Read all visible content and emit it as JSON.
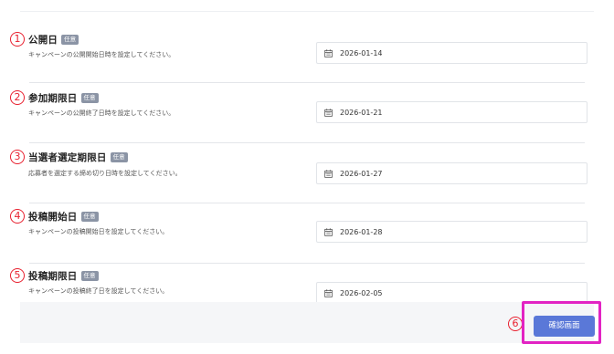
{
  "fields": [
    {
      "marker": "1",
      "title": "公開日",
      "badge": "任意",
      "description": "キャンペーンの公開開始日時を設定してください。",
      "value": "2026-01-14"
    },
    {
      "marker": "2",
      "title": "参加期限日",
      "badge": "任意",
      "description": "キャンペーンの公開終了日時を設定してください。",
      "value": "2026-01-21"
    },
    {
      "marker": "3",
      "title": "当選者選定期限日",
      "badge": "任意",
      "description": "応募者を選定する締め切り日時を設定してください。",
      "value": "2026-01-27"
    },
    {
      "marker": "4",
      "title": "投稿開始日",
      "badge": "任意",
      "description": "キャンペーンの投稿開始日を設定してください。",
      "value": "2026-01-28"
    },
    {
      "marker": "5",
      "title": "投稿期限日",
      "badge": "任意",
      "description": "キャンペーンの投稿終了日を設定してください。",
      "value": "2026-02-05"
    }
  ],
  "footer": {
    "marker": "6",
    "confirm_label": "確認画面"
  },
  "icons": {
    "field_icon": "calendar-icon"
  },
  "colors": {
    "accent": "#5a78d8",
    "marker": "#e8202f",
    "highlight": "#e223c3",
    "badge": "#8b94a5"
  }
}
